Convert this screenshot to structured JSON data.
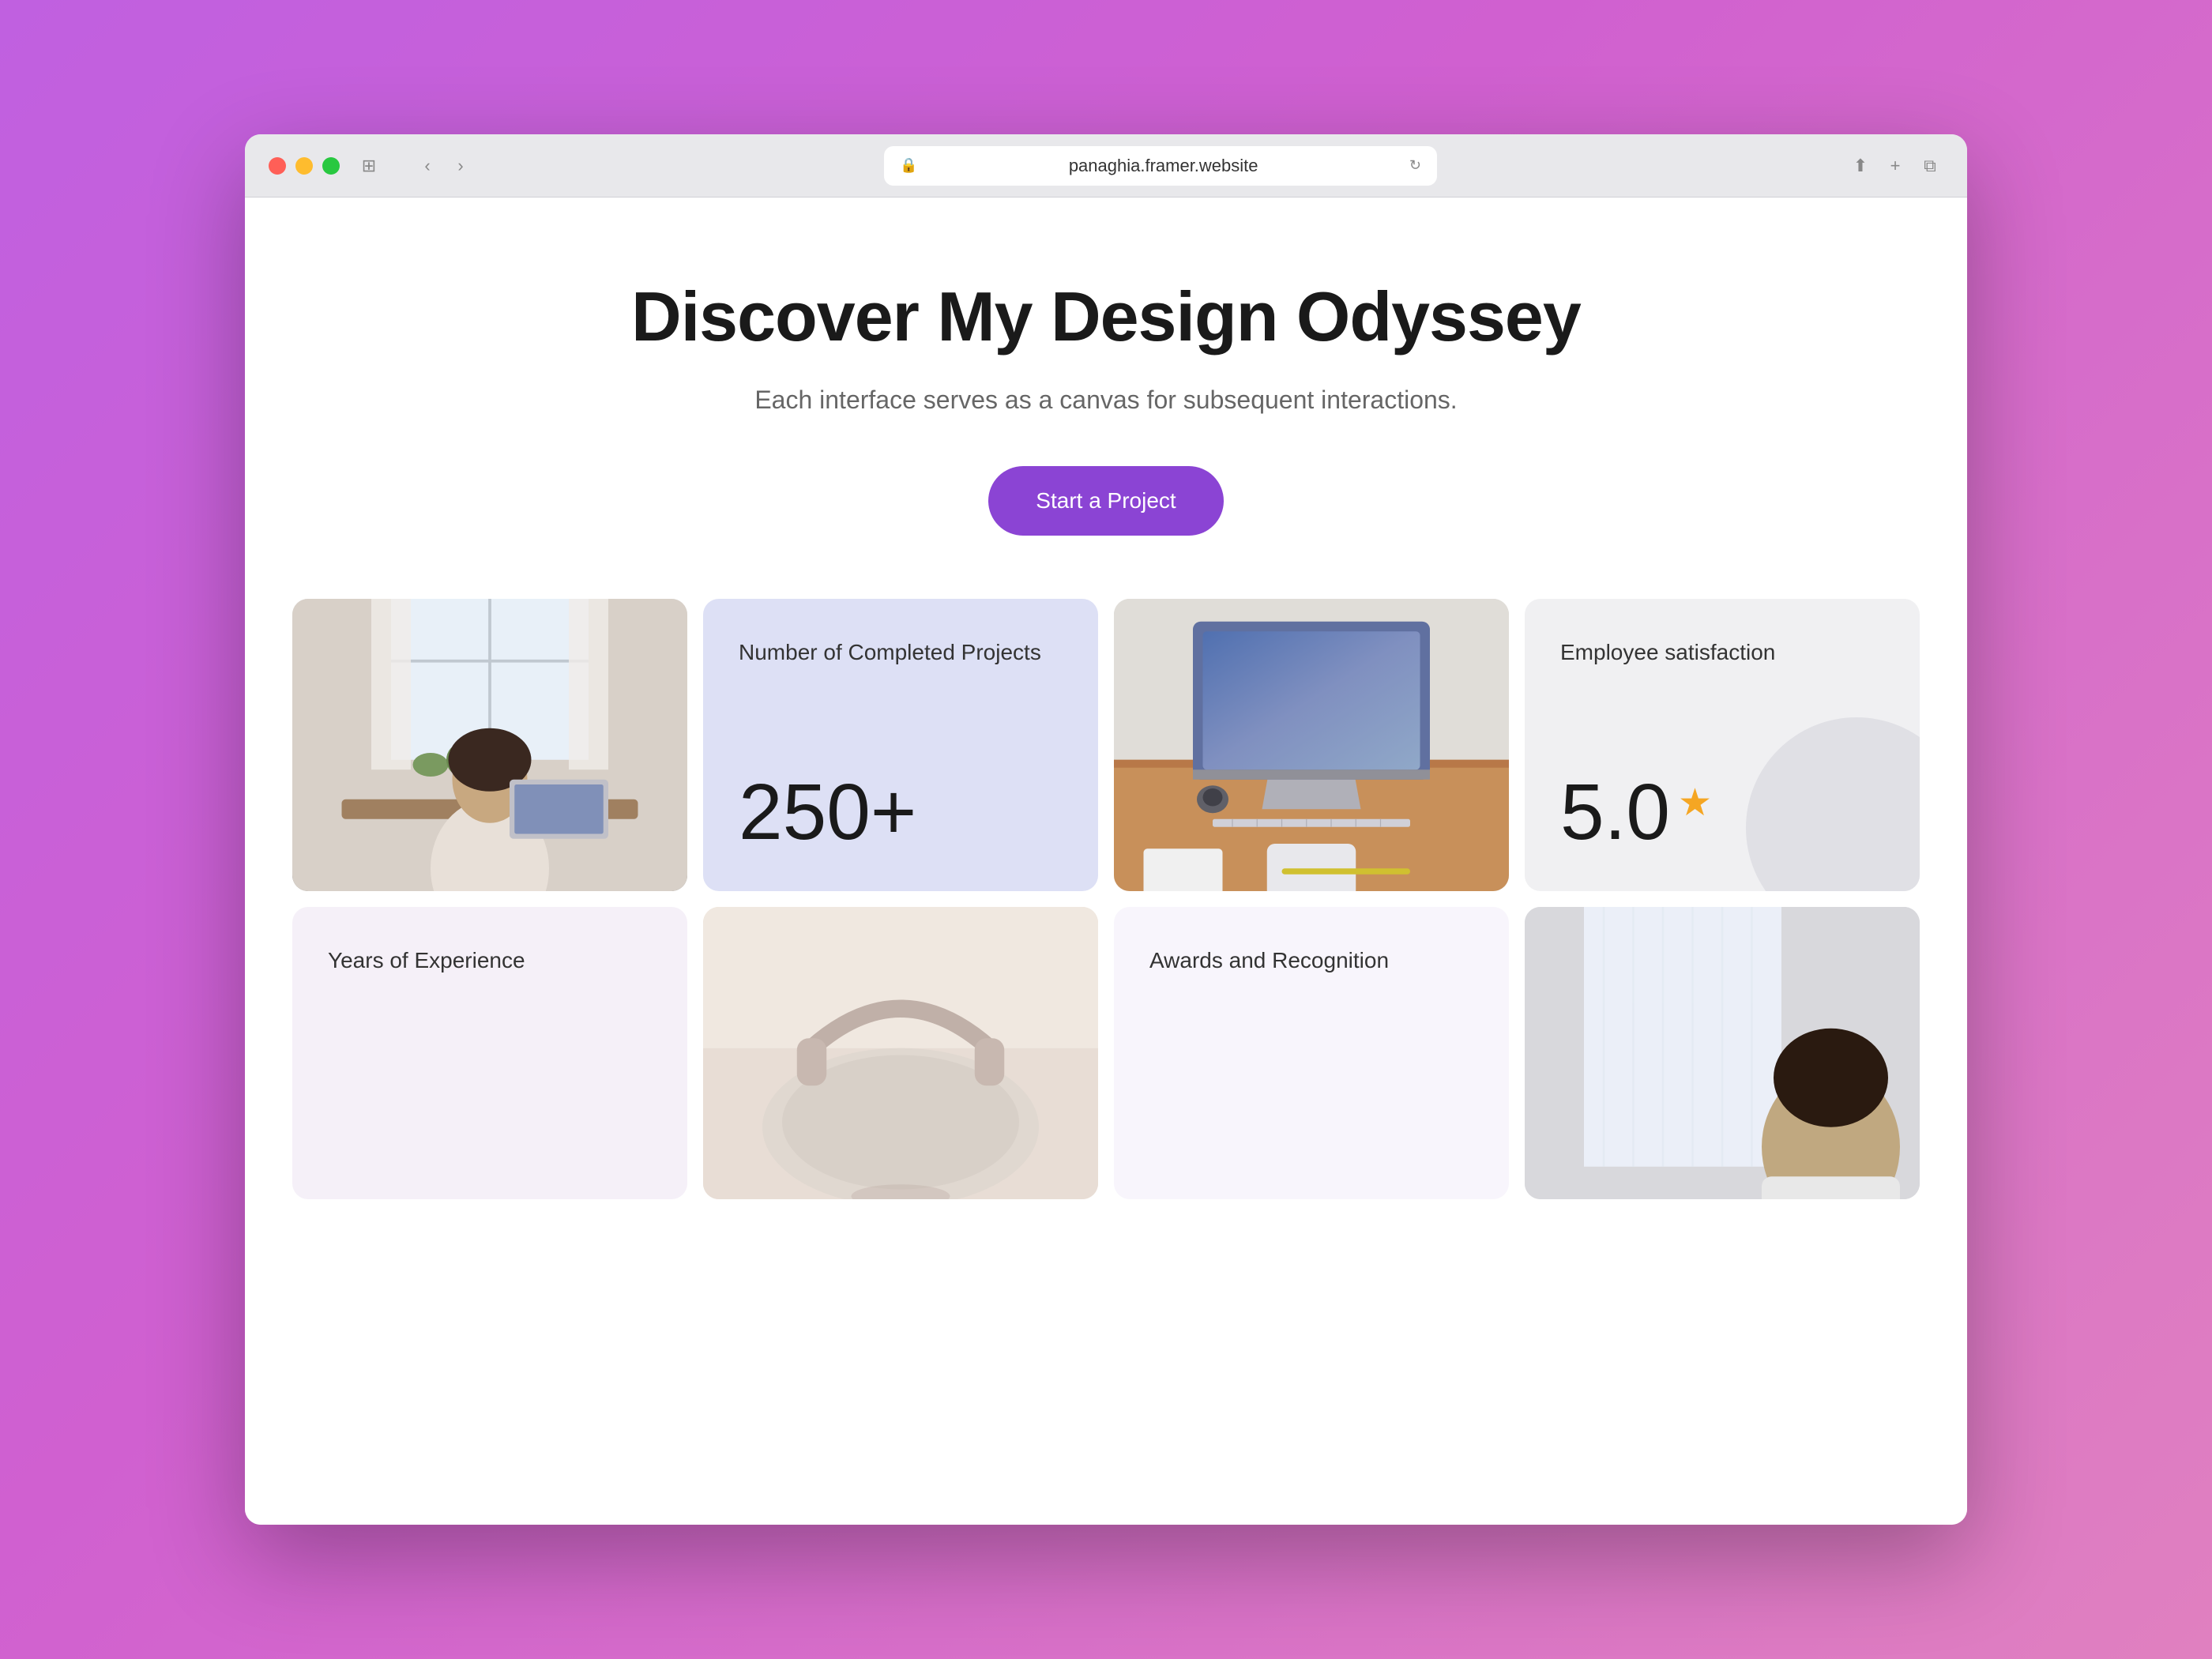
{
  "browser": {
    "url": "panaghia.framer.website",
    "back_label": "‹",
    "forward_label": "›",
    "sidebar_label": "⊞",
    "share_label": "⬆",
    "new_tab_label": "+",
    "tabs_label": "⧉"
  },
  "hero": {
    "title": "Discover My Design Odyssey",
    "subtitle": "Each interface serves as a canvas for\nsubsequent interactions.",
    "cta_label": "Start a Project"
  },
  "grid": {
    "card_projects_label": "Number of Completed Projects",
    "card_projects_value": "250+",
    "card_satisfaction_label": "Employee satisfaction",
    "card_satisfaction_value": "5.0",
    "card_years_label": "Years of Experience",
    "card_awards_label": "Awards and Recognition"
  },
  "colors": {
    "background_gradient_start": "#c060e0",
    "background_gradient_end": "#e080c0",
    "cta_button": "#8b44d4",
    "card_projects_bg": "#dde0f5",
    "card_satisfaction_bg": "#f0f0f2",
    "card_years_bg": "#f5f0f8",
    "card_awards_bg": "#f8f5fc"
  }
}
